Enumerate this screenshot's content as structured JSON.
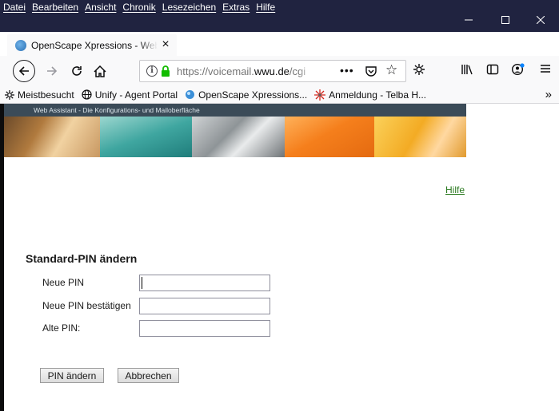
{
  "menu": [
    "Datei",
    "Bearbeiten",
    "Ansicht",
    "Chronik",
    "Lesezeichen",
    "Extras",
    "Hilfe"
  ],
  "tab": {
    "title": "OpenScape Xpressions - Web Assistant"
  },
  "urlbar": {
    "prefix": "https://voicemail.",
    "domain": "wwu.de",
    "suffix": "/cgi"
  },
  "bookmarks": [
    {
      "label": "Meistbesucht",
      "icon": "gear-icon"
    },
    {
      "label": "Unify - Agent Portal",
      "icon": "globe-icon"
    },
    {
      "label": "OpenScape Xpressions...",
      "icon": "bubble-icon"
    },
    {
      "label": "Anmeldung - Telba H...",
      "icon": "star-burst-icon"
    }
  ],
  "page": {
    "banner_text": "Web Assistant - Die Konfigurations- und Mailoberfläche",
    "help_link": "Hilfe",
    "form_title": "Standard-PIN ändern",
    "fields": [
      {
        "label": "Neue PIN",
        "value": ""
      },
      {
        "label": "Neue PIN bestätigen",
        "value": ""
      },
      {
        "label": "Alte PIN:",
        "value": ""
      }
    ],
    "buttons": {
      "change": "PIN ändern",
      "cancel": "Abbrechen"
    }
  },
  "colors": {
    "titlebar": "#202340",
    "toolbar": "#f9f9fa",
    "link": "#2b7a20",
    "banner_head": "#3b4b58"
  }
}
